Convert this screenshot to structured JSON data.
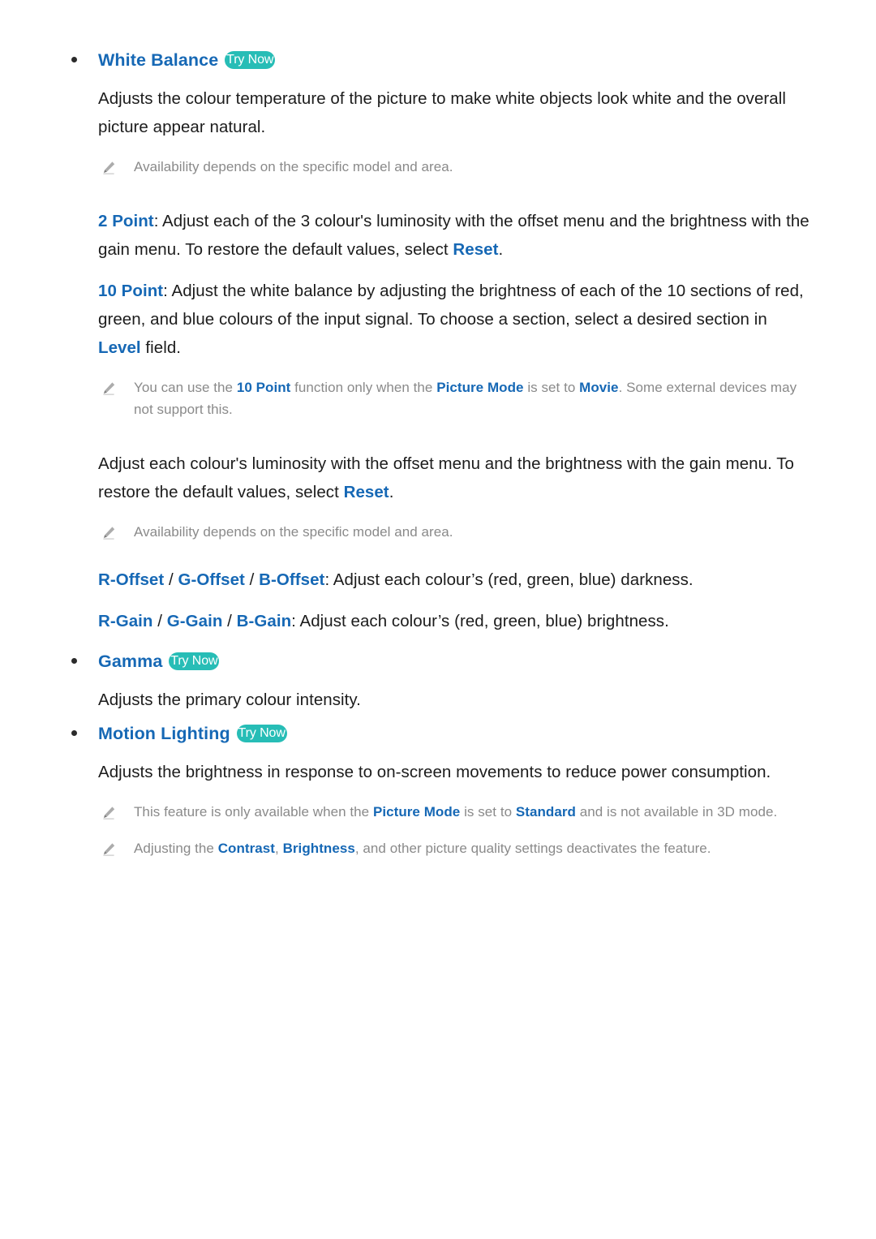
{
  "page": {
    "bullet_glyph": "•",
    "try_now_label": "Try Now",
    "accent_blue": "#1668b5",
    "badge_teal": "#27bdb6",
    "note_gray": "#8a8a8a"
  },
  "sections": {
    "white_balance": {
      "heading": "White Balance",
      "badge": "Try Now",
      "description": "Adjusts the colour temperature of the picture to make white objects look white and the overall picture appear natural.",
      "note_availability": "Availability depends on the specific model and area.",
      "two_point": {
        "term": "2 Point",
        "colon": ":",
        "text_a": " Adjust each of the 3 colour's luminosity with the offset menu and the brightness with the gain menu. To restore the default values, select ",
        "reset": "Reset",
        "text_b": "."
      },
      "ten_point": {
        "term": "10 Point",
        "colon": ":",
        "text_a": " Adjust the white balance by adjusting the brightness of each of the 10 sections of red, green, and blue colours of the input signal. To choose a section, select a desired section in ",
        "level": "Level",
        "text_b": " field."
      },
      "note_ten_point": {
        "text_a": "You can use the ",
        "kw_ten_point": "10 Point",
        "text_b": " function only when the ",
        "kw_picture_mode": "Picture Mode",
        "text_c": " is set to ",
        "kw_movie": "Movie",
        "text_d": ". Some external devices may not support this."
      },
      "adjust_paragraph": {
        "text_a": "Adjust each colour's luminosity with the offset menu and the brightness with the gain menu. To restore the default values, select ",
        "reset": "Reset",
        "text_b": "."
      },
      "note_availability_2": "Availability depends on the specific model and area.",
      "offsets": {
        "r": "R-Offset",
        "g": "G-Offset",
        "b": "B-Offset",
        "separator": " / ",
        "colon": ":",
        "text": " Adjust each colour’s (red, green, blue) darkness."
      },
      "gains": {
        "r": "R-Gain",
        "g": "G-Gain",
        "b": "B-Gain",
        "separator": " / ",
        "colon": ":",
        "text": " Adjust each colour’s (red, green, blue) brightness."
      }
    },
    "gamma": {
      "heading": "Gamma",
      "badge": "Try Now",
      "description": "Adjusts the primary colour intensity."
    },
    "motion_lighting": {
      "heading": "Motion Lighting",
      "badge": "Try Now",
      "description": "Adjusts the brightness in response to on-screen movements to reduce power consumption.",
      "note_standard": {
        "text_a": "This feature is only available when the ",
        "kw_picture_mode": "Picture Mode",
        "text_b": " is set to ",
        "kw_standard": "Standard",
        "text_c": " and is not available in 3D mode."
      },
      "note_contrast": {
        "text_a": "Adjusting the ",
        "kw_contrast": "Contrast",
        "comma": ", ",
        "kw_brightness": "Brightness",
        "text_b": ", and other picture quality settings deactivates the feature."
      }
    }
  }
}
